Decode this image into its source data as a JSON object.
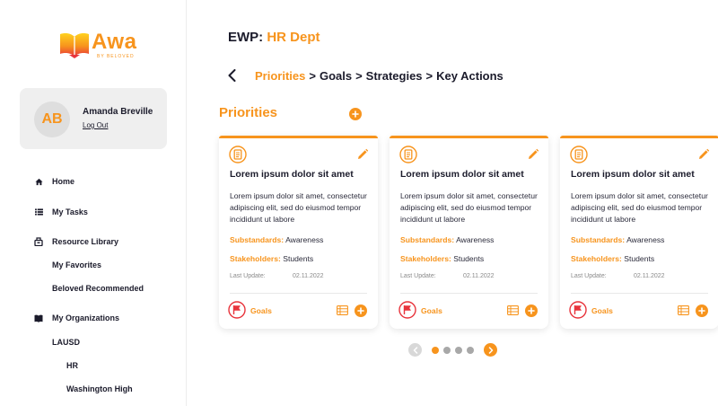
{
  "brand": {
    "name": "Awa",
    "tagline": "BY BELOVED",
    "color": "#f7941d"
  },
  "user": {
    "initials": "AB",
    "name": "Amanda Breville",
    "logout_label": "Log Out"
  },
  "nav": {
    "home": "Home",
    "tasks": "My Tasks",
    "resource_library": "Resource Library",
    "favorites": "My Favorites",
    "recommended": "Beloved Recommended",
    "organizations": "My Organizations",
    "org_lausd": "LAUSD",
    "org_hr": "HR",
    "org_washington": "Washington High"
  },
  "header": {
    "prefix": "EWP:",
    "dept": "HR Dept"
  },
  "breadcrumb": {
    "active": "Priorities",
    "sep": ">",
    "goals": "Goals",
    "strategies": "Strategies",
    "key_actions": "Key Actions"
  },
  "section": {
    "title": "Priorities"
  },
  "cards": [
    {
      "title": "Lorem ipsum dolor sit amet",
      "description": "Lorem ipsum dolor sit amet, consectetur adipiscing elit, sed do eiusmod tempor incididunt ut labore",
      "substandards_label": "Substandards:",
      "substandards_value": "Awareness",
      "stakeholders_label": "Stakeholders:",
      "stakeholders_value": "Students",
      "update_label": "Last Update:",
      "update_value": "02.11.2022",
      "goals_label": "Goals"
    },
    {
      "title": "Lorem ipsum dolor sit amet",
      "description": "Lorem ipsum dolor sit amet, consectetur adipiscing elit, sed do eiusmod tempor incididunt ut labore",
      "substandards_label": "Substandards:",
      "substandards_value": "Awareness",
      "stakeholders_label": "Stakeholders:",
      "stakeholders_value": "Students",
      "update_label": "Last Update:",
      "update_value": "02.11.2022",
      "goals_label": "Goals"
    },
    {
      "title": "Lorem ipsum dolor sit amet",
      "description": "Lorem ipsum dolor sit amet, consectetur adipiscing elit, sed do eiusmod tempor incididunt ut labore",
      "substandards_label": "Substandards:",
      "substandards_value": "Awareness",
      "stakeholders_label": "Stakeholders:",
      "stakeholders_value": "Students",
      "update_label": "Last Update:",
      "update_value": "02.11.2022",
      "goals_label": "Goals"
    }
  ],
  "pagination": {
    "pages": 4,
    "current": 1
  },
  "icons": {
    "home": "home-icon",
    "tasks": "list-icon",
    "library": "library-icon",
    "orgs": "book-icon",
    "edit": "pencil-icon",
    "add": "plus-icon",
    "goal": "flag-icon",
    "priority": "clipboard-icon"
  }
}
